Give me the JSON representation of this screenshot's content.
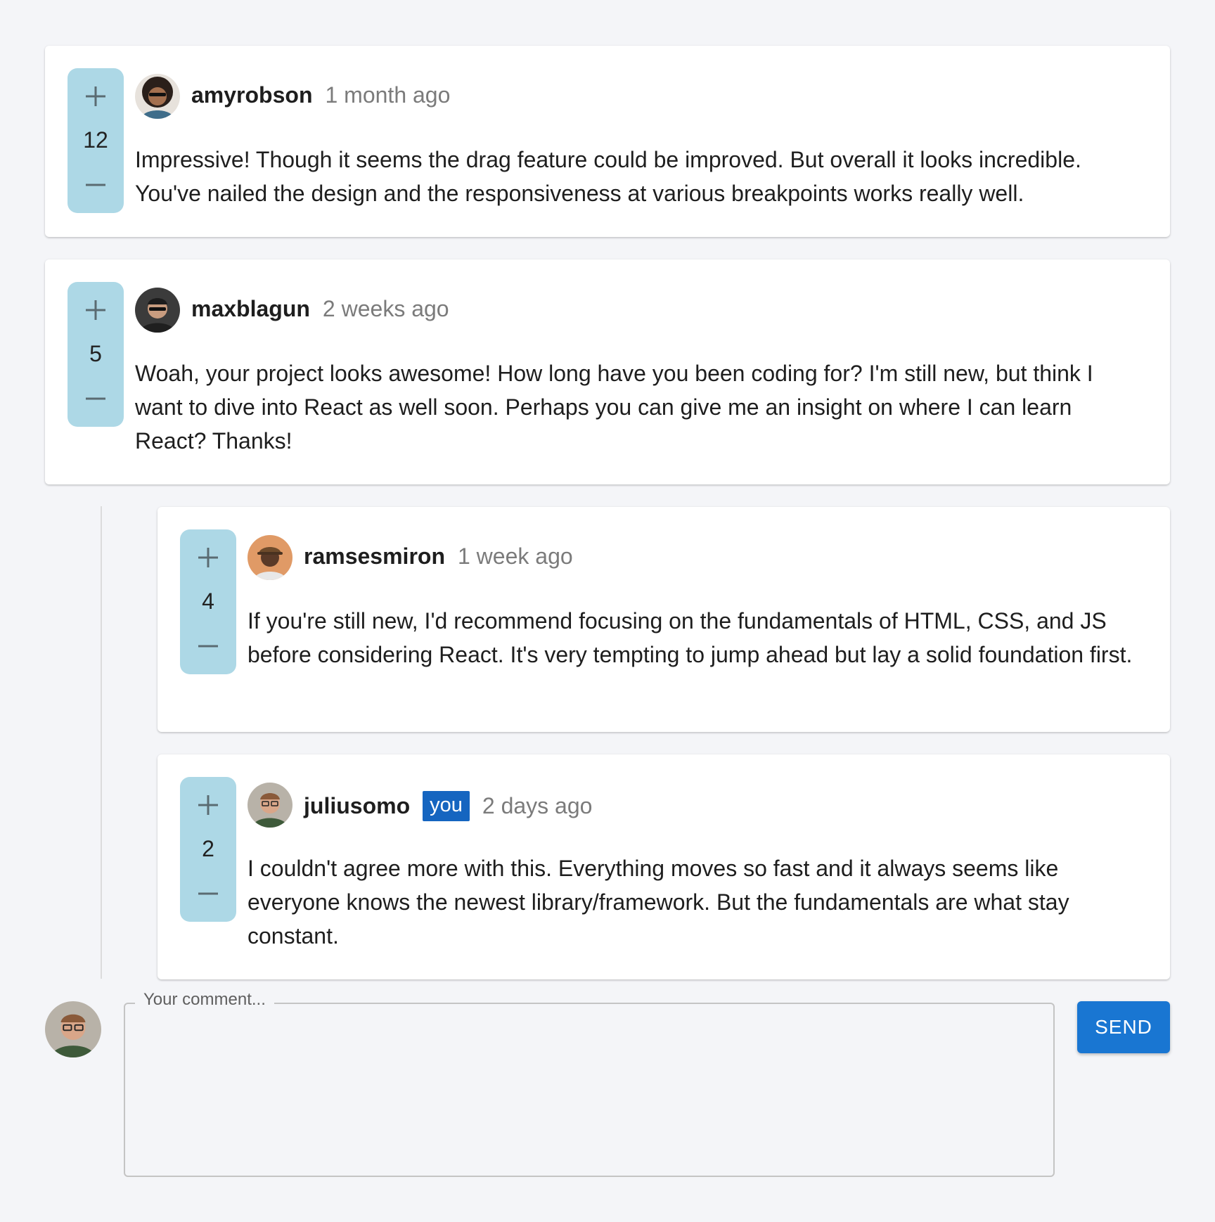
{
  "comments": [
    {
      "username": "amyrobson",
      "time": "1 month ago",
      "score": "12",
      "is_you": false,
      "text": "Impressive! Though it seems the drag feature could be improved. But overall it looks incredible. You've nailed the design and the responsiveness at various breakpoints works really well."
    },
    {
      "username": "maxblagun",
      "time": "2 weeks ago",
      "score": "5",
      "is_you": false,
      "text": "Woah, your project looks awesome! How long have you been coding for? I'm still new, but think I want to dive into React as well soon. Perhaps you can give me an insight on where I can learn React? Thanks!"
    }
  ],
  "replies": [
    {
      "username": "ramsesmiron",
      "time": "1 week ago",
      "score": "4",
      "is_you": false,
      "text": "If you're still new, I'd recommend focusing on the fundamentals of HTML, CSS, and JS before considering React. It's very tempting to jump ahead but lay a solid foundation first."
    },
    {
      "username": "juliusomo",
      "time": "2 days ago",
      "score": "2",
      "is_you": true,
      "you_label": "you",
      "text": "I couldn't agree more with this. Everything moves so fast and it always seems like everyone knows the newest library/framework. But the fundamentals are what stay constant."
    }
  ],
  "composer": {
    "placeholder": "Your comment...",
    "value": "",
    "send_label": "SEND"
  },
  "icons": {
    "upvote": "plus-icon",
    "downvote": "minus-icon"
  },
  "colors": {
    "vote_bg": "#add8e6",
    "you_badge": "#1565c0",
    "send_button": "#1976d2",
    "page_bg": "#f4f5f8"
  }
}
